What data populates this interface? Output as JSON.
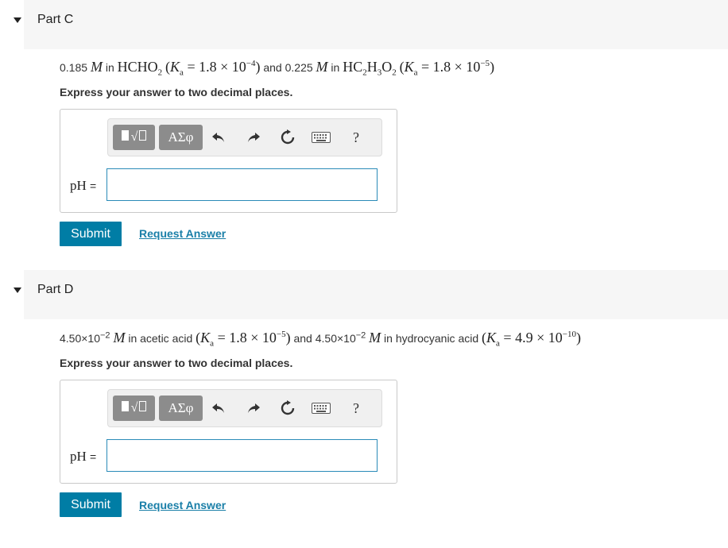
{
  "parts": [
    {
      "title": "Part C",
      "question": {
        "c1": "0.185",
        "c2": " and 0.225 "
      },
      "instruction": "Express your answer to two decimal places.",
      "answer_label": "pH",
      "answer_value": "",
      "submit_label": "Submit",
      "request_label": "Request Answer"
    },
    {
      "title": "Part D",
      "question": {
        "d1": "4.50×10",
        "d1exp": "−2",
        "d2": " in acetic acid ",
        "d3": " and 4.50×10",
        "d3exp": "−2",
        "d4": " in hydrocyanic acid "
      },
      "instruction": "Express your answer to two decimal places.",
      "answer_label": "pH",
      "answer_value": "",
      "submit_label": "Submit",
      "request_label": "Request Answer"
    }
  ],
  "toolbar": {
    "greek_label": "ΑΣφ",
    "help_label": "?",
    "icons": [
      "templates-icon",
      "greek-symbols-icon",
      "undo-icon",
      "redo-icon",
      "reset-icon",
      "keyboard-icon",
      "help-icon"
    ]
  },
  "colors": {
    "accent": "#007da5",
    "link": "#1a7fa8",
    "input_border": "#2a8bb8",
    "header_bg": "#f6f6f6"
  }
}
